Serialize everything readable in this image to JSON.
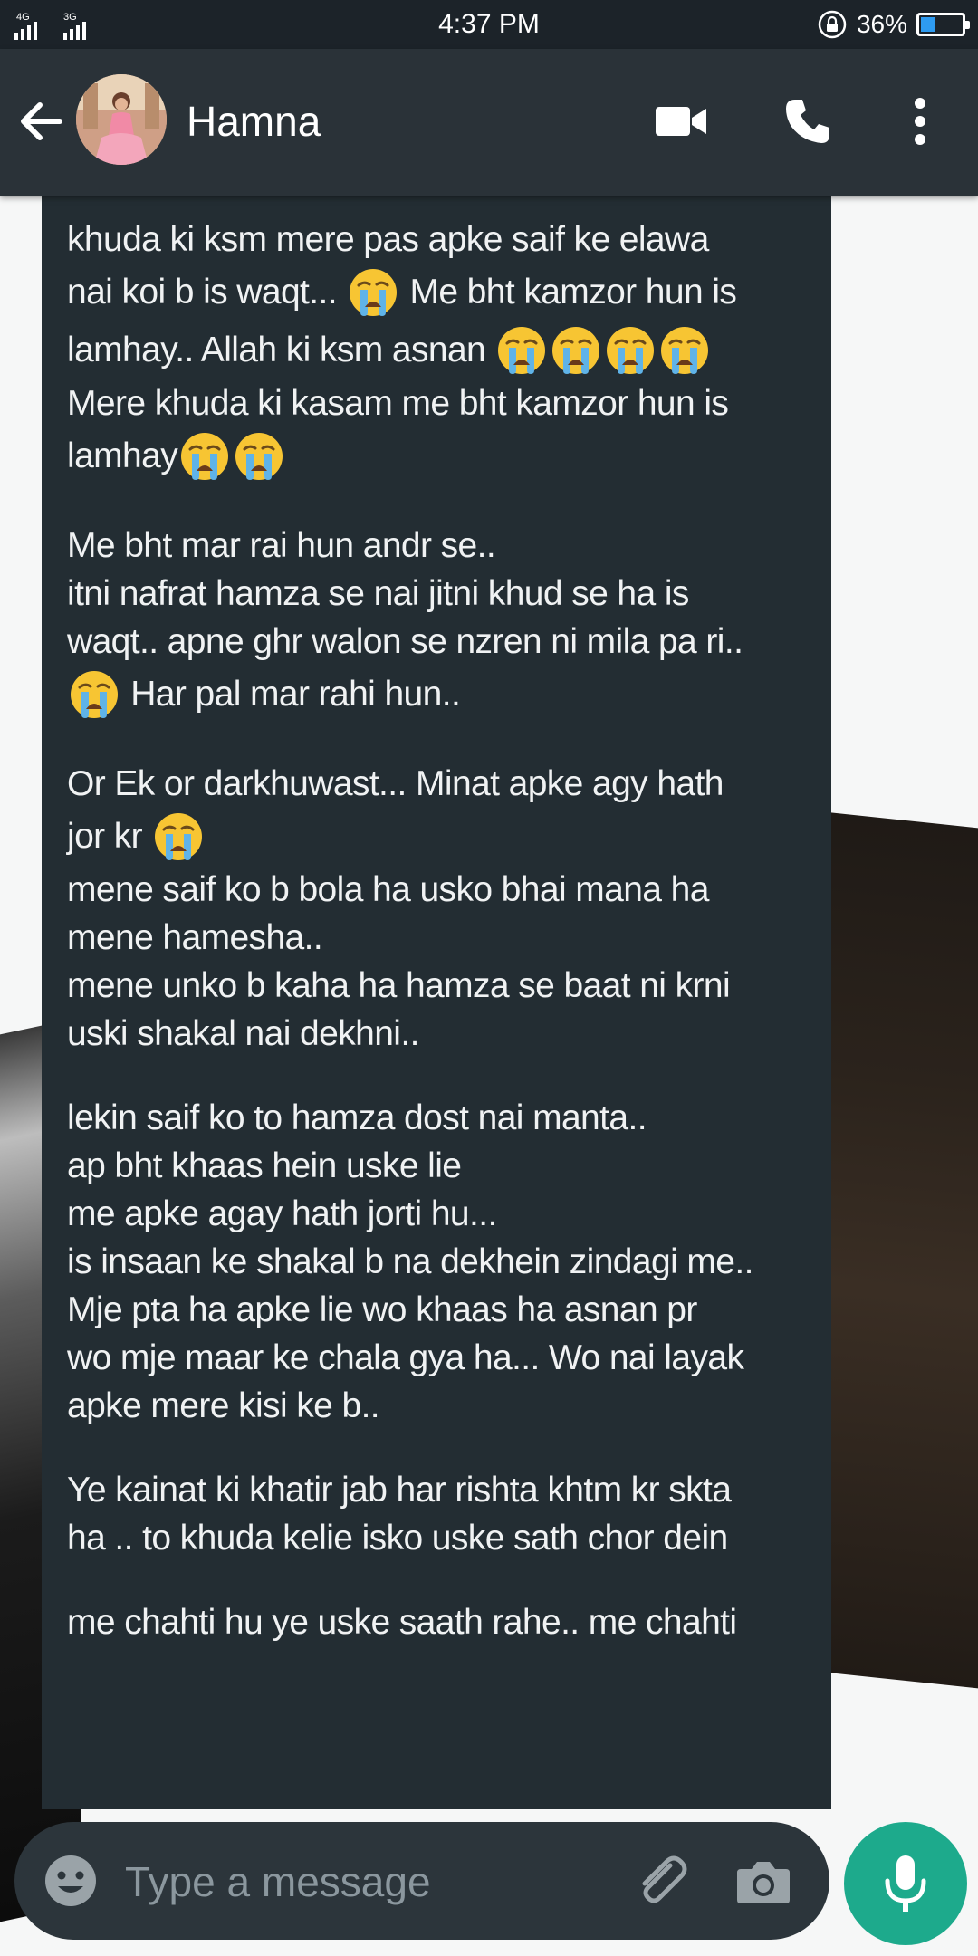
{
  "status_bar": {
    "network_1": "4G",
    "network_2": "3G",
    "time": "4:37 PM",
    "battery_percent_label": "36%",
    "battery_level": 0.36
  },
  "header": {
    "contact_name": "Hamna",
    "icons": [
      "back-arrow-icon",
      "avatar",
      "video-call-icon",
      "phone-call-icon",
      "more-options-icon"
    ]
  },
  "message": {
    "lines": [
      {
        "segments": [
          {
            "text": "khuda ki ksm mere pas apke saif ke elawa"
          }
        ]
      },
      {
        "segments": [
          {
            "text": "nai koi b is waqt... "
          },
          {
            "emoji": "crying-face"
          },
          {
            "text": " Me bht kamzor hun is"
          }
        ],
        "tall": true
      },
      {
        "segments": [
          {
            "text": "lamhay.. Allah ki ksm asnan "
          },
          {
            "emoji": "crying-face"
          },
          {
            "emoji": "crying-face"
          },
          {
            "emoji": "crying-face"
          },
          {
            "emoji": "crying-face"
          }
        ],
        "tall": true
      },
      {
        "segments": [
          {
            "text": "Mere khuda ki kasam me bht kamzor hun is"
          }
        ]
      },
      {
        "segments": [
          {
            "text": "lamhay"
          },
          {
            "emoji": "crying-face"
          },
          {
            "emoji": "crying-face"
          }
        ],
        "tall": true
      },
      {
        "blank": true
      },
      {
        "segments": [
          {
            "text": "Me bht mar rai hun andr se.."
          }
        ]
      },
      {
        "segments": [
          {
            "text": "itni nafrat hamza se nai jitni khud se ha is"
          }
        ]
      },
      {
        "segments": [
          {
            "text": "waqt.. apne ghr walon se nzren ni mila pa ri.."
          }
        ]
      },
      {
        "segments": [
          {
            "emoji": "crying-face"
          },
          {
            "text": " Har pal mar rahi hun.."
          }
        ],
        "tall": true
      },
      {
        "blank": true
      },
      {
        "segments": [
          {
            "text": "Or Ek or darkhuwast... Minat apke agy hath"
          }
        ]
      },
      {
        "segments": [
          {
            "text": "jor kr "
          },
          {
            "emoji": "crying-face"
          }
        ],
        "tall": true
      },
      {
        "segments": [
          {
            "text": "mene saif ko b bola ha usko bhai mana ha"
          }
        ]
      },
      {
        "segments": [
          {
            "text": "mene hamesha.."
          }
        ]
      },
      {
        "segments": [
          {
            "text": "mene unko b kaha ha hamza se baat ni krni"
          }
        ]
      },
      {
        "segments": [
          {
            "text": "uski shakal nai dekhni.."
          }
        ]
      },
      {
        "blank": true
      },
      {
        "segments": [
          {
            "text": "lekin saif ko to hamza dost nai manta.."
          }
        ]
      },
      {
        "segments": [
          {
            "text": "ap bht khaas hein uske lie"
          }
        ]
      },
      {
        "segments": [
          {
            "text": "me apke agay hath jorti hu..."
          }
        ]
      },
      {
        "segments": [
          {
            "text": "is insaan ke shakal b na dekhein zindagi me.."
          }
        ]
      },
      {
        "segments": [
          {
            "text": "Mje pta ha apke lie wo khaas ha asnan pr"
          }
        ]
      },
      {
        "segments": [
          {
            "text": "wo mje maar ke chala gya ha... Wo nai layak"
          }
        ]
      },
      {
        "segments": [
          {
            "text": "apke mere kisi ke b.."
          }
        ]
      },
      {
        "blank": true
      },
      {
        "segments": [
          {
            "text": "Ye kainat ki khatir jab har rishta khtm kr skta"
          }
        ]
      },
      {
        "segments": [
          {
            "text": "ha .. to khuda kelie isko uske sath chor dein"
          }
        ]
      },
      {
        "blank": true
      },
      {
        "segments": [
          {
            "text": "me chahti hu ye uske saath rahe.. me chahti"
          }
        ]
      }
    ]
  },
  "composer": {
    "placeholder": "Type a message",
    "icons": [
      "smiley-icon",
      "attachment-icon",
      "camera-icon",
      "microphone-icon"
    ]
  },
  "colors": {
    "status_bar": "#1c2329",
    "toolbar": "#2a3238",
    "bubble": "#232d33",
    "input_bar": "#2c353b",
    "mic_button": "#1daa8c",
    "battery_fill": "#2e9bf0"
  }
}
